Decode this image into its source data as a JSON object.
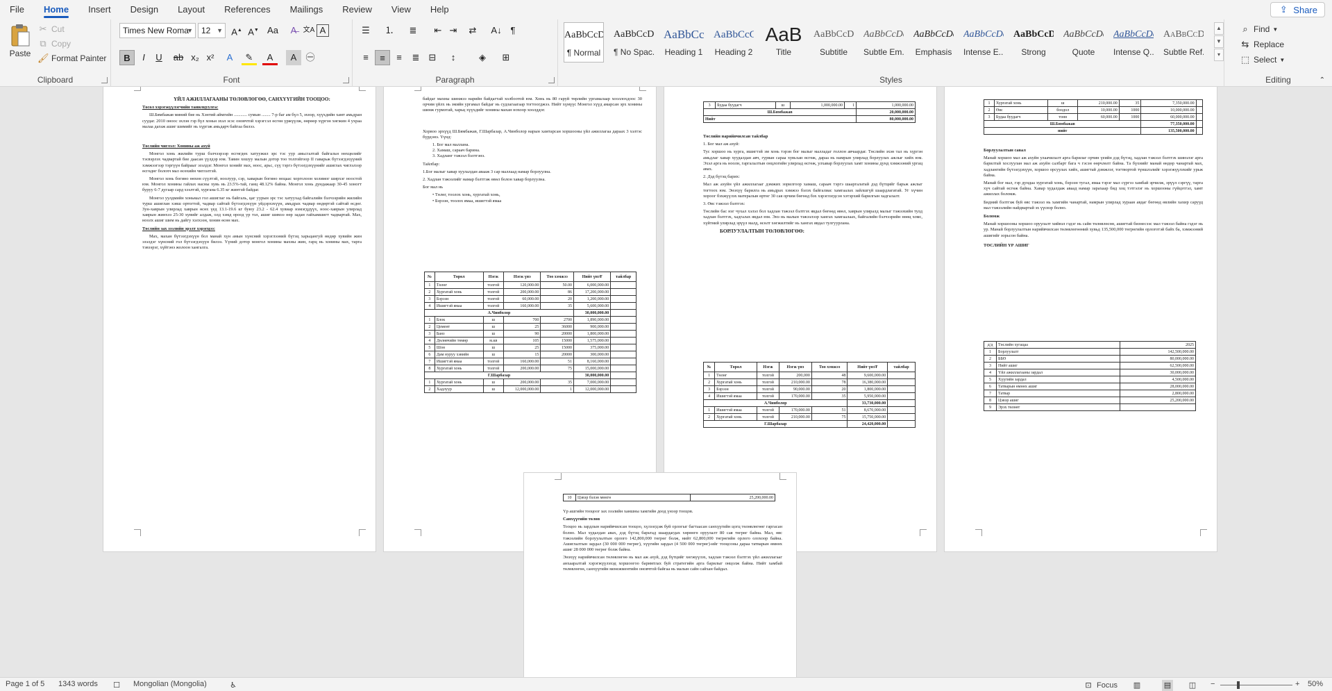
{
  "tabs": [
    "File",
    "Home",
    "Insert",
    "Design",
    "Layout",
    "References",
    "Mailings",
    "Review",
    "View",
    "Help"
  ],
  "active_tab": "Home",
  "share_label": "Share",
  "clipboard": {
    "paste": "Paste",
    "cut": "Cut",
    "copy": "Copy",
    "format_painter": "Format Painter",
    "label": "Clipboard"
  },
  "font": {
    "name": "Times New Roma",
    "size": "12",
    "label": "Font"
  },
  "paragraph": {
    "label": "Paragraph"
  },
  "styles": {
    "label": "Styles",
    "items": [
      {
        "preview": "AaBbCcDc",
        "name": "¶ Normal"
      },
      {
        "preview": "AaBbCcDc",
        "name": "¶ No Spac..."
      },
      {
        "preview": "AaBbCc",
        "name": "Heading 1"
      },
      {
        "preview": "AaBbCcC",
        "name": "Heading 2"
      },
      {
        "preview": "AaB",
        "name": "Title"
      },
      {
        "preview": "AaBbCcDc",
        "name": "Subtitle"
      },
      {
        "preview": "AaBbCcDc",
        "name": "Subtle Em..."
      },
      {
        "preview": "AaBbCcDc",
        "name": "Emphasis"
      },
      {
        "preview": "AaBbCcDc",
        "name": "Intense E..."
      },
      {
        "preview": "AaBbCcDc",
        "name": "Strong"
      },
      {
        "preview": "AaBbCcDc",
        "name": "Quote"
      },
      {
        "preview": "AaBbCcDc",
        "name": "Intense Q..."
      },
      {
        "preview": "AaBbCcDc",
        "name": "Subtle Ref..."
      }
    ]
  },
  "editing": {
    "find": "Find",
    "replace": "Replace",
    "select": "Select",
    "label": "Editing"
  },
  "status": {
    "page": "Page 1 of 5",
    "words": "1343 words",
    "language": "Mongolian (Mongolia)",
    "focus": "Focus",
    "zoom": "50%"
  },
  "doc": {
    "p1_title": "ҮЙЛ АЖИЛЛАГААНЫ ТӨЛӨВЛӨГӨӨ, САНХҮҮГИЙН ТООЦОО:",
    "p1_h1": "Төсөл хэрэгжүүлэгчийн танилцуулга:",
    "p1_t1": "Ш.Бямбажав миний бие нь Хэнтий аймгийн ............ сумын ........ 7-р баг ам бүл 5, эхнэр, хүүхдийн хамт амьдран суудаг. 2010 оноос эхлэн гэр бүл хоньн эхэл эсэс оновчтой хэрэгсэл өсгөн үржүүлж, өөрөөр хүргэн хөгжин 4 ухраа малаа дагаж ашиг шимийг нь хүргэж амьдарч байгаа билээ.",
    "p1_h2": "Төслийн чиглэл: Хонины аж ахуй",
    "p1_t2": "Монгол хонь жилийн турш бэлчээрээр өсгөгдөх хатуужил эрс тэс уур амьсгалтай байгальн нөхцөлийг тэсвэрлэх чадвартай бие даасан үүлдэр юм. Тавин хошуу малын дотор тоо толгойгоор II гаварьж бүтээгдэхүүний хэмжээгээр тэргүүн байраыг эзэлдэг. Монгол хонийг мах, ноос, арьс, сүү тэргэ бүтээгдэхүүнийг ашиглах чиглэлээр өсгөдөг болохч мал өсөхийн чиглэлтэй.",
    "p1_t3": "Монгол хонь богино өөхөн сүүлтэй, ноолуур, сэр, хаварын богино ноцаас хорголоон холимог ширхэг ноостой юм. Монгол хонины гайлах насны хувь нь 23.5%-тай, ганц 48.12% байна. Монгол хонь дундажаар 30-45 хоногт буруу 6-7 дугаар сард хээлтэй, хургана 6.35 кг жинтэй байдаг.",
    "p1_t4": "Монгол уулдмийн хоньмал гол ашиглаг нь байгаль, цаг уурын эрс тэс хатуухад байгалийн бэлчээрийн жилийн турш ашиглан хэвш ортогтой, чадвар сайтай бүтээгдэхүүн уйдэрхэхүүн, амьдрах чадвар өндөртэй сайтай өсдөг. Зун-хаврын улирлад хаврын өсөх үед 13.1-19.6 кг буюу 23.2 - 62.4 хувиар нэмэгддүүх, ноос-хаврын улирлад хаврын жинхээ 25-30 хувийг алдаж, олд хэмд ороод ур тэл, ашиг шимээ өөр задан гайхамшигт чадвартай. Мах, ноолх ашиг шим нь дайгу хэлхээн, хонин өсөн мах.",
    "p1_h3": "Төслийн зах зээлийн эрэлт хэрэгцээ:",
    "p1_t5": "Мах, махан бүтээгдэхүүн бол манай хүн амын хүнсний хэрэглээний бүтэц харьцангуй өндөр хувийн жин эзэлдэг хүнсний гол бүтээгдэхүүн билээ. Үүний дотор монгол хонины махны жин, гарц нь хонины мах, тарга тэвээрэг, хүйтэнэ жолоон хангалга.",
    "p2_t1": "байдаг махны шинжээ нарийн байдагтай холбоотой юм. Хонь нь 80 гаруй төрлийн ургамалаар хооллохдоос 30 орчим үйлх нь эмийн ургамал байдаг нь судлагаагаар тогтоогджээ. Нийт хүмүүс Монгол хүүд амарсан эрх хонины шинж гурмэтай, харьц хүүхдийг хонины махан нохоор хоолддог.",
    "p2_t2": "Хорвоо эрхүүд Ш.Бямбажав, Г.Шарбазар, А.Чинболор нарын хамтарсан хоршооны үйл ажиллагаа дараах 3 хэлтэс бүрдэнэ. Үүнд:",
    "p2_list1": [
      "Бог мал маллана.",
      "Хамаш, сараач барина.",
      "Хадланг тэжээл бэлтгэнэ."
    ],
    "p2_t3": "Тайлбар:",
    "p2_t4": "1.Бог малыг хавар хуулалдан авааж 3 сар маллаад намар борлуулна.",
    "p2_t5": "2. Хадлан тэжээлийг намар бэлтгэж өвөл болон хавар борлуулна.",
    "p2_t6": "Бог мал нь",
    "p2_list2": [
      "Төлөг, тоолох хонь, хургатай хонь,",
      "Бэрээн, тоолох ямаа, ишигтэй ямаа"
    ],
    "t_header": [
      "№",
      "Төрөл",
      "Нэгж",
      "Нэгж үнэ",
      "Тоо хэмжээ",
      "Нийт үнэ₮",
      "тайлбар"
    ],
    "p2_rows1": [
      [
        "1",
        "Төлөг",
        "толгой",
        "120,000.00",
        "50.00",
        "6,000,000.00"
      ],
      [
        "2",
        "Хургатай хонь",
        "толгой",
        "200,000.00",
        "86",
        "17,200,000.00"
      ],
      [
        "3",
        "Бэрээн",
        "толгой",
        "60,000.00",
        "20",
        "1,200,000.00"
      ],
      [
        "4",
        "Ишигтэй ямаа",
        "толгой",
        "160,000.00",
        "35",
        "5,600,000.00"
      ]
    ],
    "p2_sub1": "А.Чинболор",
    "p2_sum1": "30,000,000.00",
    "p2_rows2": [
      [
        "1",
        "Блок",
        "ш",
        "700",
        "2700",
        "1,890,000.00"
      ],
      [
        "2",
        "Цемент",
        "ш",
        "25",
        "36000",
        "900,000.00"
      ],
      [
        "3",
        "Банз",
        "ш",
        "90",
        "20000",
        "1,800,000.00"
      ],
      [
        "4",
        "Дөлөвчийн төмөр",
        "м.кв",
        "105",
        "15000",
        "1,575,000.00"
      ],
      [
        "5",
        "Шон",
        "ш",
        "25",
        "15000",
        "375,000.00"
      ],
      [
        "6",
        "Дам нуруу хэвийн",
        "ш",
        "15",
        "20000",
        "300,000.00"
      ],
      [
        "7",
        "Ишигтэй ямаа",
        "толгой",
        "160,000.00",
        "51",
        "8,160,000.00"
      ],
      [
        "8",
        "Хургатай хонь",
        "толгой",
        "200,000.00",
        "75",
        "15,000,000.00"
      ]
    ],
    "p2_sub2": "Г.Шарбазар",
    "p2_sum2": "30,000,000.00",
    "p2_rows3": [
      [
        "1",
        "Хургатай хонь",
        "ш",
        "200,000.00",
        "35",
        "7,000,000.00"
      ],
      [
        "2",
        "Хадлуур",
        "ш",
        "12,000,000.00",
        "1",
        "12,000,000.00"
      ]
    ],
    "p3_rows_top": [
      [
        "3",
        "Будаа буудагч",
        "ш",
        "1,000,000.00",
        "1",
        "1,000,000.00"
      ]
    ],
    "p3_sub_top": "Ш.Бямбажав",
    "p3_sum_top": "20,000,000.00",
    "p3_total_label": "Нийт",
    "p3_total": "80,000,000.00",
    "p3_h1": "Төслийн нарийвчилсан тайлбар",
    "p3_l1": "1. Бог мал аж ахуй:",
    "p3_t1": "Тус хоршоо нь хурга, ишигтэй эм хонь тэрэн бог малыг малладаг голлон авчаардаг. Төслийн эхэн тал нь хүргэн амьдлаг хавар хуудалдан авч, гурван сараа хувьхан өсгөж, дараа нь намрын улирлад борлуулах ажлыг хийх юм. Эхэл арга нь ноолн, гаргалалтын онцлогийн улирлад өсгөж, улхавар борлуулах хамт хонины дунд хэмжээний ургац авах.",
    "p3_l2": "2. Дэд бүтэц барих:",
    "p3_t2": "Мал аж ахуйн үйл ажиллагааг дэмжих зорилгоор хамаш, сараач тэргэ шааргалатай дэд бүтцийг барьж ажлыг тогтоох юм. Энэхүү барилга нь амьдрах хэмжээ бэлэх байгалиас хамгаалах зайлшгүй шаардлагатай. Уг хүчин хороог бэхжүүлэх матералын өртөг 30 сая орчим бөгөөд бэх хэрэглэгдсэн хэтэрхий барилгын хадгалалт.",
    "p3_l3": "3. Өвс тэжээл бэлтгэх:",
    "p3_t3": "Төслийн бас нэг чухал хэлэл бол хадлан тэжээл бэлтгэх явдал бөгөөд өвөл, хаврын улиралд малыг тэжээхийн тулд хадлан бэлтгэх, хадгалах явдал юм. Энэ нь малын тэжээлээр хангах хамгаалаах, байгалийн бэлчээрийн нөөц хомс, хүйтний улирлад эрүүл малд, өсөлт хөгжилтийг нь хангах явдал тулгуурлана.",
    "p3_h2": "БОРЛУУЛАЛТЫН ТӨЛӨВЛӨГӨӨ:",
    "p3_rows1": [
      [
        "1",
        "Төлөг",
        "толгой",
        "200,000",
        "48",
        "9,600,000.00"
      ],
      [
        "2",
        "Хургатай хонь",
        "толгой",
        "210,000.00",
        "78",
        "16,380,000.00"
      ],
      [
        "3",
        "Бэрээн",
        "толгой",
        "90,000.00",
        "20",
        "1,800,000.00"
      ],
      [
        "4",
        "Ишигтэй ямаа",
        "толгой",
        "170,000.00",
        "35",
        "5,950,000.00"
      ]
    ],
    "p3_sub1": "А.Чинболор",
    "p3_sum1": "33,730,000.00",
    "p3_rows2": [
      [
        "1",
        "Ишигтэй ямаа",
        "толгой",
        "170,000.00",
        "51",
        "8,670,000.00"
      ],
      [
        "2",
        "Хургатай хонь",
        "толгой",
        "210,000.00",
        "75",
        "15,750,000.00"
      ]
    ],
    "p3_sub2": "Г.Шарбазар",
    "p3_sum2": "24,420,000.00",
    "p4_rows1": [
      [
        "1",
        "Хургатай хонь",
        "ш",
        "210,000.00",
        "35",
        "7,350,000.00"
      ],
      [
        "2",
        "Өвс",
        "боодол",
        "10,000.00",
        "1000",
        "10,000,000.00"
      ],
      [
        "3",
        "Будаа буудагч",
        "тонн",
        "60,000.00",
        "1000",
        "60,000,000.00"
      ]
    ],
    "p4_sub1": "Ш.Бямбажав",
    "p4_sum1": "77,350,000.00",
    "p4_total_label": "нийт",
    "p4_total": "135,500,000.00",
    "p4_h1": "Борлуулалтын савал",
    "p4_t1": "Манай хоршоо мал аж ахуйн улаачилалт арга барилаг орчин үеийн дэд бүтэц, хадлан тэжээл бэлтгэх шинэлэг арга барилтай хослуулан мал аж ахуйн салбарт багa ч гэсэн өөрчлөлт байна. Та бүхнийг манай өндөр чанартай мах, хадлангийн бүтээгдэхүүн, хоршоо орсуулах хийх, ашигтай дэмжлэг, тогтвортой түншлэлийг хэрэгжүүлэхийг урьж байна.",
    "p4_t2": "Манай бог мал, гэр дундаа хургатай хонь, бэрээн тугал, ямаа тэрэг мал сүргээ хамбай эрчилж, эрүүл сэргүү, тарга хүч сайтай өсгөж байна. Хавар худалдаж аваад намар зарахаар бид хоц тэтгэлэг нь хоршооны гүйцэтгэл, хамт ажиллах боломж.",
    "p4_t3": "Бидний бэлтгэж буй өвс тэжээл нь хамгийн чанартай, намрын улирлад хураан авдаг бөгөөд өвлийн хахир сарууд мал тэжээлийн найдвартай эх үүсвэр болно.",
    "p4_h2": "Боломж",
    "p4_t4": "Манай хоршооны хоршоо оруулалт хийвэл гэдэг нь сайн төлөвлөсөн, ашигтай бизнесээс мал тэжээл байна гэдэг нь ур. Манай борлуулалтын нарийвчилсан төлөвлөгөөний хувьд 135,500,000 төгрөгийн орлоготэй байх ба, хэмжээний ашигийг зорьсон байна.",
    "p4_h3": "ТӨСЛИЙН ҮР АШИГ",
    "p4_rows2": [
      [
        "д/д",
        "Төслийн хугацаа",
        "2025"
      ],
      [
        "1",
        "Борлуулалт",
        "142,500,000.00"
      ],
      [
        "2",
        "ББӨ",
        "80,000,000.00"
      ],
      [
        "3",
        "Нийт ашиг",
        "62,500,000.00"
      ],
      [
        "4",
        "Үйл ажиллагааны зардал",
        "30,000,000.00"
      ],
      [
        "5",
        "Хүүгийн зардал",
        "4,500,000.00"
      ],
      [
        "6",
        "Татварын өмнөх ашиг",
        "28,000,000.00"
      ],
      [
        "7",
        "Татвар",
        "2,800,000.00"
      ],
      [
        "8",
        "Цэвэр ашиг",
        "25,200,000.00"
      ],
      [
        "9",
        "Эрэх төлөөт",
        ""
      ]
    ],
    "p5_row": [
      "10",
      "Цэвэр бэлэн мөнгө",
      "25,200,000.00"
    ],
    "p5_t1": "Үр ашгийн тооцоог зах зээлийн ханшны хамгийн доод үнээр тооцов.",
    "p5_h1": "Санхүүгийн төлөв",
    "p5_t2": "Тооцоо нь зардлын нарийвчилсан тооцоо, хүлээгдэж буй орлогыг багтаасан санхүүгийн цогц төлөвлөгөөг гаргасан болно. Мал худалдан авах, дэд бүтэц барьтад шаардагдах хөрөнгө оруулалт 80 сая төгрөг байна. Мал, өвс тэжээлийн борлуулалтын орлого 142,800,000 төгрөг болж, нийт 62,800,000 төгрөгийн орлого олохоор байна. Ашиглалтын зардал (30 000 000 төгрөг), хүүгийн зардал (4 500 000 төгрөг)-ийг тооцсоны дараа татварын өмнөх ашиг 28 000 000 төгрөг болж байна.",
    "p5_t3": "Энэхүү нарийвчилсан төлөвлөгөө нь мал аж ахуй, дэд бүтцийг хөгжүүлэх, хадлан тэжээл бэлтгэх үйл ажиллагааг анхааралтай хэрэгжүүлэхэд хоршоогоо баримтлах буй стратегийн арга барилыг онцолж байна. Нийт хамбай төлөвлөгөө, санхүүгийн менежментийн оновчтой байгаа нь малын сайн сайхан байдал."
  }
}
